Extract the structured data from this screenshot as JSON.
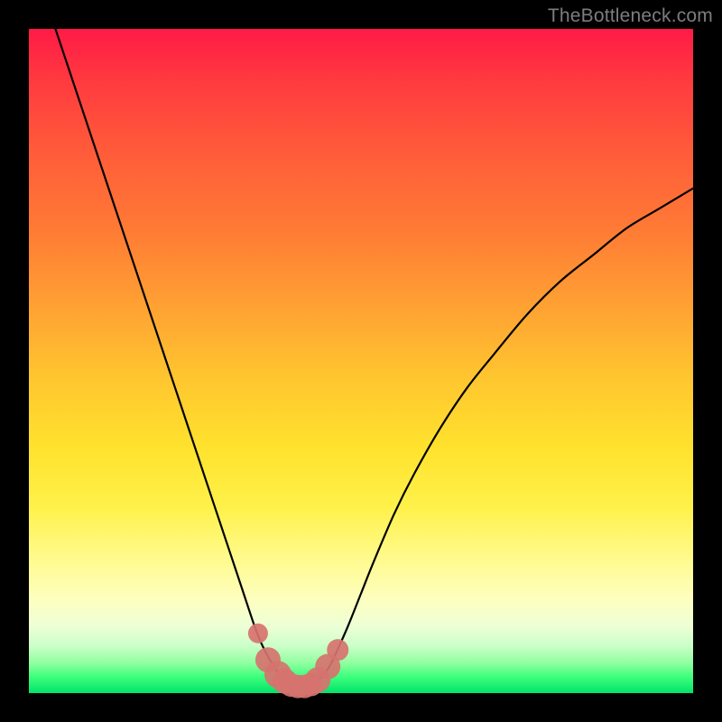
{
  "watermark": "TheBottleneck.com",
  "chart_data": {
    "type": "line",
    "title": "",
    "xlabel": "",
    "ylabel": "",
    "xlim": [
      0,
      100
    ],
    "ylim": [
      0,
      100
    ],
    "grid": false,
    "series": [
      {
        "name": "bottleneck-curve",
        "color": "#000000",
        "x": [
          4,
          6,
          8,
          10,
          12,
          14,
          16,
          18,
          20,
          22,
          24,
          26,
          28,
          30,
          32,
          34,
          35,
          36,
          37,
          38,
          39,
          40,
          41,
          42,
          43,
          44,
          45,
          46,
          48,
          50,
          52,
          55,
          58,
          62,
          66,
          70,
          75,
          80,
          85,
          90,
          95,
          100
        ],
        "y": [
          100,
          94,
          88,
          82,
          76,
          70,
          64,
          58,
          52,
          46,
          40,
          34,
          28,
          22,
          16,
          10,
          7.5,
          5.5,
          3.8,
          2.5,
          1.6,
          1.1,
          0.9,
          1.0,
          1.4,
          2.3,
          3.6,
          5.5,
          10,
          15,
          20,
          27,
          33,
          40,
          46,
          51,
          57,
          62,
          66,
          70,
          73,
          76
        ]
      }
    ],
    "markers": [
      {
        "name": "measurement-dots",
        "color": "#d6736f",
        "x": [
          34.5,
          36,
          37.5,
          38.5,
          39.5,
          40.5,
          41.5,
          42.5,
          43.5,
          45,
          46.5
        ],
        "y": [
          9.0,
          5.0,
          2.8,
          1.8,
          1.2,
          1.0,
          1.0,
          1.3,
          2.0,
          4.0,
          6.5
        ],
        "size": [
          11,
          14,
          15,
          14,
          13,
          13,
          13,
          13,
          14,
          14,
          12
        ]
      }
    ]
  }
}
